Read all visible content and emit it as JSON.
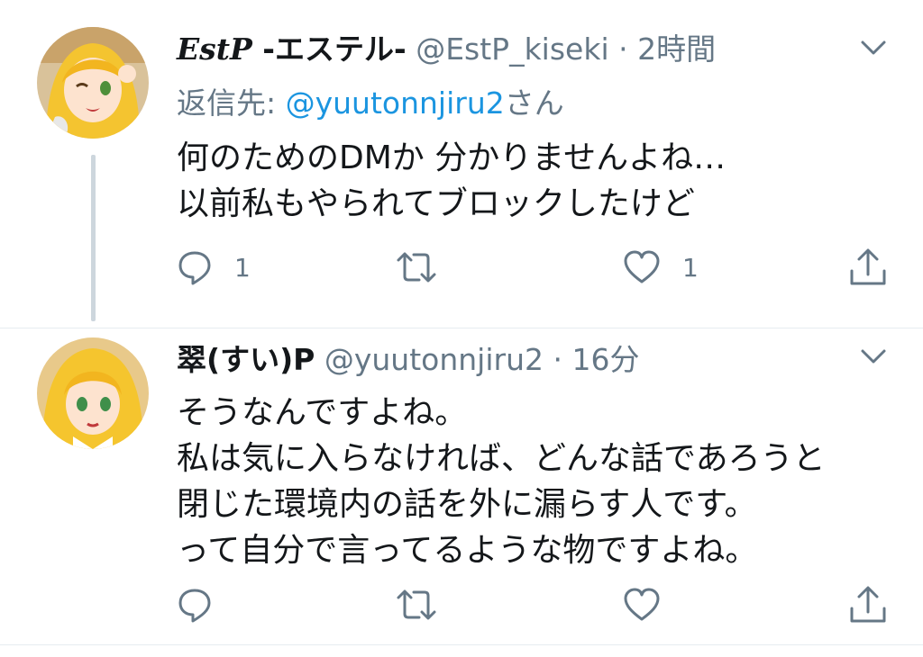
{
  "tweets": [
    {
      "display_name_latin": "EstP",
      "display_name_rest": " -エステル-",
      "handle": "@EstP_kiseki",
      "separator": "·",
      "time": "2時間",
      "reply_prefix": "返信先: ",
      "reply_handle": "@yuutonnjiru2",
      "reply_suffix": "さん",
      "lines": [
        "何のためのDMか 分かりませんよね…",
        "以前私もやられてブロックしたけど"
      ],
      "reply_count": "1",
      "retweet_count": "",
      "like_count": "1"
    },
    {
      "display_name": "翠(すい)P",
      "handle": "@yuutonnjiru2",
      "separator": "·",
      "time": "16分",
      "lines": [
        "そうなんですよね。",
        "私は気に入らなければ、どんな話であろうと",
        "閉じた環境内の話を外に漏らす人です。",
        "って自分で言ってるような物ですよね。"
      ],
      "reply_count": "",
      "retweet_count": "",
      "like_count": ""
    }
  ],
  "icons": {
    "menu": "chevron-down-icon",
    "reply": "reply-icon",
    "retweet": "retweet-icon",
    "like": "heart-icon",
    "share": "share-icon"
  },
  "colors": {
    "text": "#14171a",
    "muted": "#657786",
    "link": "#1b95e0",
    "thread_line": "#cdd6dd"
  }
}
